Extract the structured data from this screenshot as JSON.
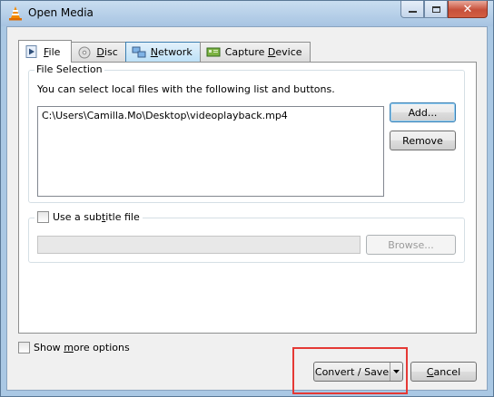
{
  "window": {
    "title": "Open Media"
  },
  "tabs": [
    {
      "label": "File",
      "underline": "F",
      "rest": "ile",
      "icon": "file-play-icon"
    },
    {
      "label": "Disc",
      "underline": "D",
      "rest": "isc",
      "icon": "disc-icon"
    },
    {
      "label": "Network",
      "underline": "N",
      "rest": "etwork",
      "icon": "network-icon"
    },
    {
      "label": "Capture Device",
      "pre": "Capture ",
      "underline": "D",
      "rest": "evice",
      "icon": "capture-card-icon"
    }
  ],
  "file_selection": {
    "title": "File Selection",
    "description": "You can select local files with the following list and buttons.",
    "files": [
      "C:\\Users\\Camilla.Mo\\Desktop\\videoplayback.mp4"
    ],
    "add_label": "Add...",
    "remove_label": "Remove"
  },
  "subtitle": {
    "checkbox_pre": "Use a sub",
    "checkbox_ul": "t",
    "checkbox_post": "itle file",
    "checked": false,
    "path_value": "",
    "browse_label": "Browse..."
  },
  "show_more": {
    "pre": "Show ",
    "ul": "m",
    "post": "ore options",
    "checked": false
  },
  "footer": {
    "convert_label": "Convert / Save",
    "cancel_ul": "C",
    "cancel_rest": "ancel"
  },
  "colors": {
    "highlight": "#e53935",
    "accent": "#3c7fb1"
  }
}
